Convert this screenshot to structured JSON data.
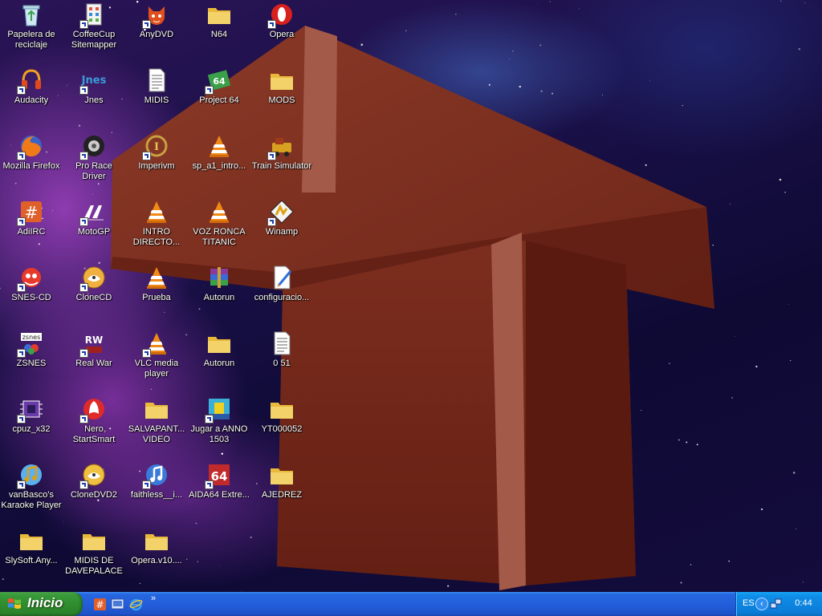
{
  "desktop": {
    "icons": [
      {
        "label": "Papelera de reciclaje",
        "type": "recycle-bin",
        "shortcut": false
      },
      {
        "label": "CoffeeCup Sitemapper",
        "type": "app-coffeecup",
        "shortcut": true
      },
      {
        "label": "AnyDVD",
        "type": "app-anydvd",
        "shortcut": true
      },
      {
        "label": "N64",
        "type": "folder",
        "shortcut": false
      },
      {
        "label": "Opera",
        "type": "app-opera",
        "shortcut": true
      },
      {
        "label": "Audacity",
        "type": "app-audacity",
        "shortcut": true
      },
      {
        "label": "Jnes",
        "type": "app-jnes",
        "shortcut": true
      },
      {
        "label": "MIDIS",
        "type": "document",
        "shortcut": false
      },
      {
        "label": "Project 64",
        "type": "app-project64",
        "shortcut": true
      },
      {
        "label": "MODS",
        "type": "folder",
        "shortcut": false
      },
      {
        "label": "Mozilla Firefox",
        "type": "app-firefox",
        "shortcut": true
      },
      {
        "label": "Pro Race Driver",
        "type": "app-racedriver",
        "shortcut": true
      },
      {
        "label": "Imperivm",
        "type": "app-imperivm",
        "shortcut": true
      },
      {
        "label": "sp_a1_intro...",
        "type": "vlc",
        "shortcut": false
      },
      {
        "label": "Train Simulator",
        "type": "app-train",
        "shortcut": true
      },
      {
        "label": "AdiIRC",
        "type": "app-adiirc",
        "shortcut": true
      },
      {
        "label": "MotoGP",
        "type": "app-motogp",
        "shortcut": true
      },
      {
        "label": "INTRO DIRECTO...",
        "type": "vlc",
        "shortcut": false
      },
      {
        "label": "VOZ RONCA TITANIC",
        "type": "vlc",
        "shortcut": false
      },
      {
        "label": "Winamp",
        "type": "app-winamp",
        "shortcut": true
      },
      {
        "label": "SNES-CD",
        "type": "app-snes",
        "shortcut": true
      },
      {
        "label": "CloneCD",
        "type": "app-clonecd",
        "shortcut": true
      },
      {
        "label": "Prueba",
        "type": "vlc",
        "shortcut": false
      },
      {
        "label": "Autorun",
        "type": "app-winrar",
        "shortcut": false
      },
      {
        "label": "configuracio...",
        "type": "document-edit",
        "shortcut": false
      },
      {
        "label": "ZSNES",
        "type": "app-zsnes",
        "shortcut": true
      },
      {
        "label": "Real War",
        "type": "app-realwar",
        "shortcut": true
      },
      {
        "label": "VLC media player",
        "type": "vlc",
        "shortcut": true
      },
      {
        "label": "Autorun",
        "type": "folder",
        "shortcut": false
      },
      {
        "label": "0 51",
        "type": "document",
        "shortcut": false
      },
      {
        "label": "cpuz_x32",
        "type": "app-cpuz",
        "shortcut": true
      },
      {
        "label": "Nero StartSmart",
        "type": "app-nero",
        "shortcut": true
      },
      {
        "label": "SALVAPANT... VIDEO",
        "type": "folder",
        "shortcut": false
      },
      {
        "label": "Jugar a ANNO 1503",
        "type": "app-anno",
        "shortcut": true
      },
      {
        "label": "YT000052",
        "type": "folder",
        "shortcut": false
      },
      {
        "label": "vanBasco's Karaoke Player",
        "type": "app-vanbasco",
        "shortcut": true
      },
      {
        "label": "CloneDVD2",
        "type": "app-clonedvd",
        "shortcut": true
      },
      {
        "label": "faithless__i...",
        "type": "app-music",
        "shortcut": true
      },
      {
        "label": "AIDA64 Extre...",
        "type": "app-aida64",
        "shortcut": true
      },
      {
        "label": "AJEDREZ",
        "type": "folder",
        "shortcut": false
      },
      {
        "label": "SlySoft.Any...",
        "type": "folder",
        "shortcut": false
      },
      {
        "label": "MIDIS DE DAVEPALACE",
        "type": "folder",
        "shortcut": false
      },
      {
        "label": "Opera.v10....",
        "type": "folder",
        "shortcut": false
      }
    ],
    "colors": {
      "folder": "#f4d26a",
      "vlc": "#f08a16",
      "wallpaper_block": "#7a2a1c"
    }
  },
  "taskbar": {
    "start_label": "Inicio",
    "quick_launch": [
      {
        "name": "adiirc-quicklaunch-icon"
      },
      {
        "name": "show-desktop-icon"
      },
      {
        "name": "internet-explorer-icon"
      }
    ],
    "more_label": "»",
    "tray": {
      "language": "ES",
      "arrow": "‹",
      "clock": "0:44"
    }
  }
}
